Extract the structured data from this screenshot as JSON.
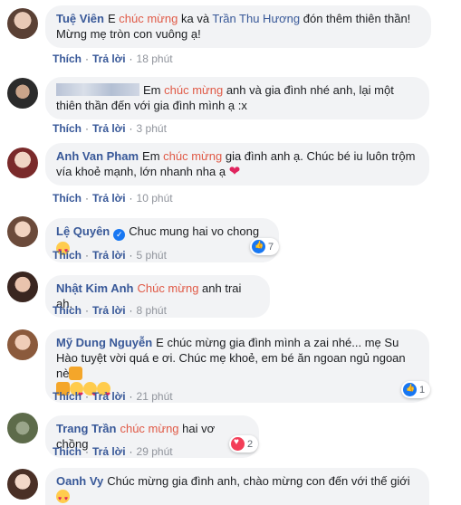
{
  "actions": {
    "like": "Thích",
    "reply": "Trả lời",
    "separator": "·"
  },
  "comments": [
    {
      "name": "Tuệ Viên",
      "text_before": "E ",
      "highlight": "chúc mừng",
      "text_after": " ka và ",
      "mention": "Trần Thu Hương",
      "text_end": " đón thêm thiên thần! Mừng mẹ tròn con vuông ạ!",
      "time": "18 phút"
    },
    {
      "name": "",
      "text_before": "Em ",
      "highlight": "chúc mừng",
      "text_after": " anh và gia đình nhé anh, lại một thiên thần đến với gia đình mình ạ :x",
      "time": "3 phút"
    },
    {
      "name": "Anh Van Pham",
      "text_before": "Em ",
      "highlight": "chúc mừng",
      "text_after": " gia đình anh ạ. Chúc bé iu luôn trộm vía khoẻ mạnh, lớn nhanh nha ạ",
      "time": "10 phút"
    },
    {
      "name": "Lệ Quyên",
      "text_before": "Chuc mung hai vo chong",
      "time": "5 phút",
      "reaction_count": "7"
    },
    {
      "name": "Nhật Kim Anh",
      "highlight": "Chúc mừng",
      "text_after": " anh trai ah.",
      "time": "8 phút"
    },
    {
      "name": "Mỹ Dung Nguyễn",
      "text_before": "E chúc mừng gia đình mình a zai nhé... mẹ Su Hào tuyệt vời quá e ơi. Chúc mẹ khoẻ, em bé ăn ngoan ngủ ngoan nè",
      "time": "21 phút",
      "reaction_count": "1"
    },
    {
      "name": "Trang Trần",
      "highlight": "chúc mừng",
      "text_after": " hai vơ chồng",
      "time": "29 phút",
      "reaction_count": "2"
    },
    {
      "name": "Oanh Vy",
      "text_before": "Chúc mừng gia đình anh, chào mừng con đến với thế giới"
    }
  ],
  "colors": {
    "name": "#385898",
    "highlight": "#e05a47",
    "bubble": "#f2f3f5"
  }
}
